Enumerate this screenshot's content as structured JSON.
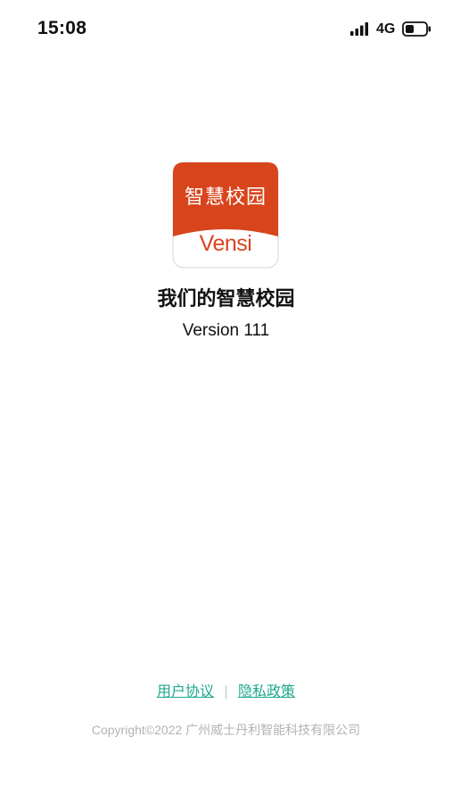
{
  "status_bar": {
    "time": "15:08",
    "network": "4G",
    "icons": [
      "signal-icon",
      "battery-icon"
    ]
  },
  "app": {
    "logo_title": "智慧校园",
    "logo_brand": "Vensi",
    "name": "我们的智慧校园",
    "version": "Version 111"
  },
  "footer": {
    "user_agreement": "用户协议",
    "divider": "|",
    "privacy_policy": "隐私政策",
    "copyright": "Copyright©2022 广州威士丹利智能科技有限公司"
  },
  "colors": {
    "logo_orange": "#d8451d",
    "link_green": "#1fa88f",
    "copyright_gray": "#b3b3b3"
  }
}
